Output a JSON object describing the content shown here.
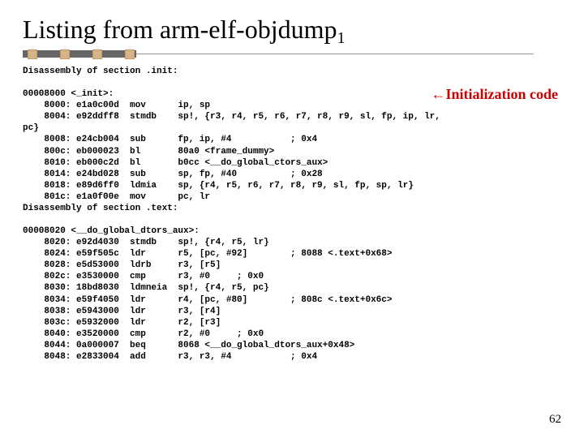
{
  "title_main": "Listing from arm-elf-objdump",
  "title_sub": "1",
  "annotation": "Initialization code",
  "page_number": "62",
  "code_block": "Disassembly of section .init:\n\n00008000 <_init>:\n    8000: e1a0c00d  mov      ip, sp\n    8004: e92ddff8  stmdb    sp!, {r3, r4, r5, r6, r7, r8, r9, sl, fp, ip, lr,\npc}\n    8008: e24cb004  sub      fp, ip, #4           ; 0x4\n    800c: eb000023  bl       80a0 <frame_dummy>\n    8010: eb000c2d  bl       b0cc <__do_global_ctors_aux>\n    8014: e24bd028  sub      sp, fp, #40          ; 0x28\n    8018: e89d6ff0  ldmia    sp, {r4, r5, r6, r7, r8, r9, sl, fp, sp, lr}\n    801c: e1a0f00e  mov      pc, lr\nDisassembly of section .text:\n\n00008020 <__do_global_dtors_aux>:\n    8020: e92d4030  stmdb    sp!, {r4, r5, lr}\n    8024: e59f505c  ldr      r5, [pc, #92]        ; 8088 <.text+0x68>\n    8028: e5d53000  ldrb     r3, [r5]\n    802c: e3530000  cmp      r3, #0     ; 0x0\n    8030: 18bd8030  ldmneia  sp!, {r4, r5, pc}\n    8034: e59f4050  ldr      r4, [pc, #80]        ; 808c <.text+0x6c>\n    8038: e5943000  ldr      r3, [r4]\n    803c: e5932000  ldr      r2, [r3]\n    8040: e3520000  cmp      r2, #0     ; 0x0\n    8044: 0a000007  beq      8068 <__do_global_dtors_aux+0x48>\n    8048: e2833004  add      r3, r3, #4           ; 0x4"
}
